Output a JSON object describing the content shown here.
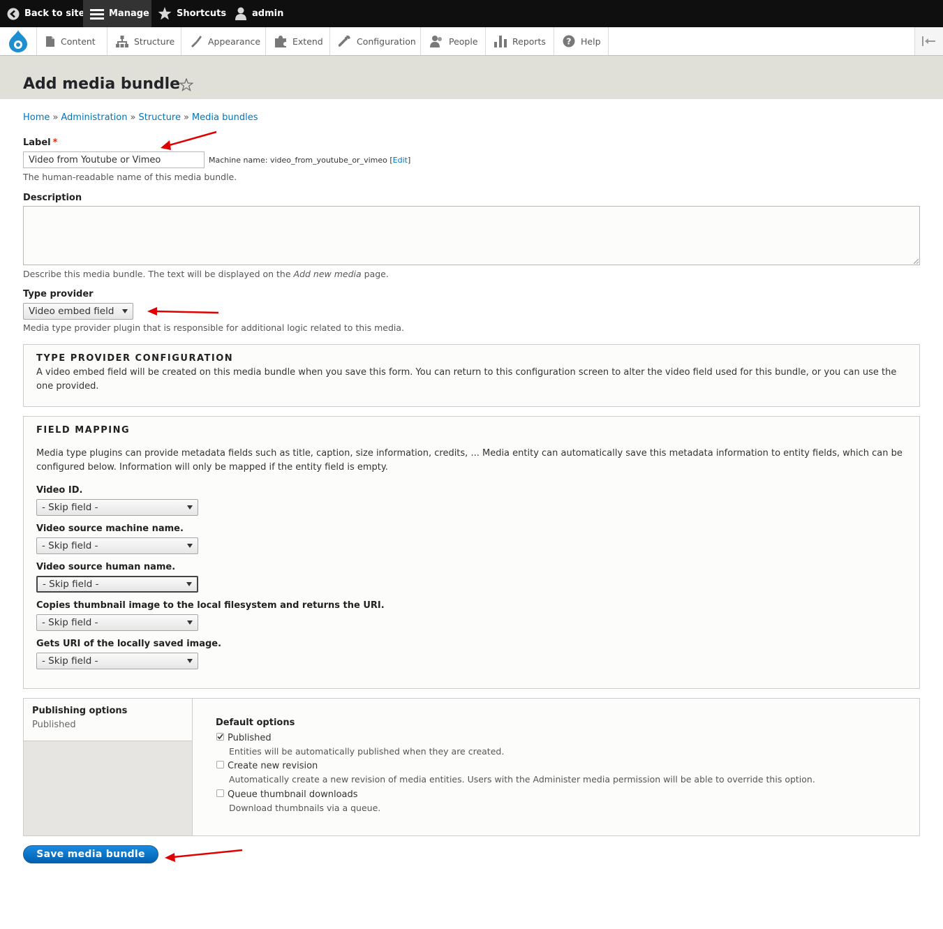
{
  "toolbar": {
    "back": "Back to site",
    "manage": "Manage",
    "shortcuts": "Shortcuts",
    "user": "admin"
  },
  "menu": {
    "items": [
      "Content",
      "Structure",
      "Appearance",
      "Extend",
      "Configuration",
      "People",
      "Reports",
      "Help"
    ]
  },
  "page": {
    "title": "Add media bundle"
  },
  "breadcrumb": [
    "Home",
    "Administration",
    "Structure",
    "Media bundles"
  ],
  "label_field": {
    "label": "Label",
    "required": "*",
    "value": "Video from Youtube or Vimeo",
    "machine_prefix": "Machine name: video_from_youtube_or_vimeo [",
    "machine_edit": "Edit",
    "machine_suffix": "]",
    "description": "The human-readable name of this media bundle."
  },
  "description_field": {
    "label": "Description",
    "help_before": "Describe this media bundle. The text will be displayed on the ",
    "help_em": "Add new media",
    "help_after": " page."
  },
  "type_provider": {
    "label": "Type provider",
    "value": "Video embed field",
    "description": "Media type provider plugin that is responsible for additional logic related to this media."
  },
  "type_config": {
    "legend": "TYPE PROVIDER CONFIGURATION",
    "text": "A video embed field will be created on this media bundle when you save this form. You can return to this configuration screen to alter the video field used for this bundle, or you can use the one provided."
  },
  "field_mapping": {
    "legend": "FIELD MAPPING",
    "text": "Media type plugins can provide metadata fields such as title, caption, size information, credits, ... Media entity can automatically save this metadata information to entity fields, which can be configured below. Information will only be mapped if the entity field is empty.",
    "fields": [
      {
        "label": "Video ID.",
        "value": "- Skip field -"
      },
      {
        "label": "Video source machine name.",
        "value": "- Skip field -"
      },
      {
        "label": "Video source human name.",
        "value": "- Skip field -"
      },
      {
        "label": "Copies thumbnail image to the local filesystem and returns the URI.",
        "value": "- Skip field -"
      },
      {
        "label": "Gets URI of the locally saved image.",
        "value": "- Skip field -"
      }
    ]
  },
  "publishing": {
    "tab_title": "Publishing options",
    "tab_summary": "Published",
    "heading": "Default options",
    "options": [
      {
        "label": "Published",
        "checked": true,
        "description": "Entities will be automatically published when they are created."
      },
      {
        "label": "Create new revision",
        "checked": false,
        "description": "Automatically create a new revision of media entities. Users with the Administer media permission will be able to override this option."
      },
      {
        "label": "Queue thumbnail downloads",
        "checked": false,
        "description": "Download thumbnails via a queue."
      }
    ]
  },
  "actions": {
    "save": "Save media bundle"
  },
  "colors": {
    "link": "#0074bd",
    "button": "#0071b8",
    "annotation_arrow": "#e00000"
  }
}
